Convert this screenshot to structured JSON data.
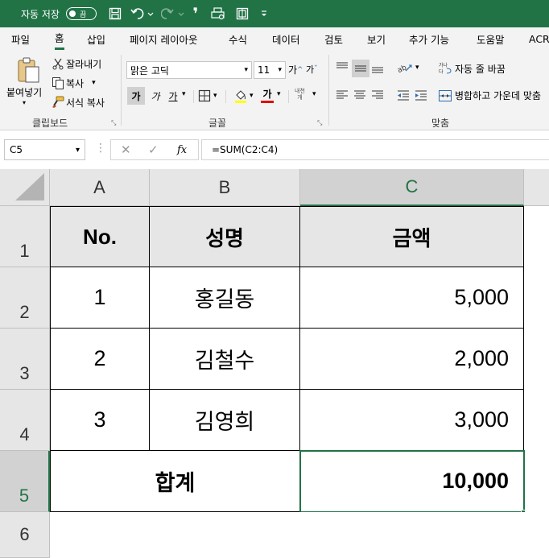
{
  "titlebar": {
    "autosave_label": "자동 저장",
    "toggle_label": "끔",
    "save_icon": "save-icon",
    "undo_icon": "undo-icon",
    "redo_icon": "redo-icon",
    "comma_glyph": "❜",
    "customize_icon": "dropdown-arrow-icon",
    "accent": "#217346"
  },
  "menu": [
    "파일",
    "홈",
    "삽입",
    "페이지 레이아웃",
    "수식",
    "데이터",
    "검토",
    "보기",
    "추가 기능",
    "도움말",
    "ACR"
  ],
  "ribbon": {
    "clipboard": {
      "paste_label": "붙여넣기",
      "cut_label": "잘라내기",
      "copy_label": "복사",
      "format_painter_label": "서식 복사",
      "group_label": "클립보드"
    },
    "font": {
      "font_name": "맑은 고딕",
      "font_size": "11",
      "grow_label": "가",
      "shrink_label": "가",
      "bold_label": "가",
      "italic_label": "가",
      "underline_label": "가",
      "font_color_label": "가",
      "phonetic_label": "내천",
      "group_label": "글꼴"
    },
    "alignment": {
      "wrap_label": "자동 줄 바꿈",
      "merge_label": "병합하고 가운데 맞춤",
      "group_label": "맞춤"
    }
  },
  "formula_bar": {
    "name_box": "C5",
    "formula": "=SUM(C2:C4)",
    "fx_label": "fx"
  },
  "sheet": {
    "columns": [
      "A",
      "B",
      "C"
    ],
    "rows": [
      "1",
      "2",
      "3",
      "4",
      "5",
      "6"
    ],
    "selected_cell": "C5",
    "header_row": {
      "a": "No.",
      "b": "성명",
      "c": "금액"
    },
    "data_rows": [
      {
        "a": "1",
        "b": "홍길동",
        "c": "5,000"
      },
      {
        "a": "2",
        "b": "김철수",
        "c": "2,000"
      },
      {
        "a": "3",
        "b": "김영희",
        "c": "3,000"
      }
    ],
    "total_row": {
      "label": "합계",
      "value": "10,000"
    }
  }
}
